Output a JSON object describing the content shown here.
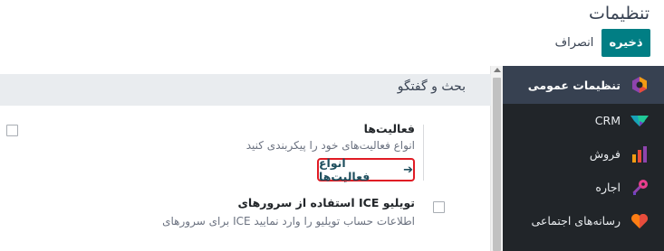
{
  "header": {
    "title": "تنظیمات",
    "save_label": "ذخیره",
    "discard_label": "انصراف"
  },
  "sidebar": {
    "items": [
      {
        "label": "تنظیمات عمومی",
        "icon": "settings-hexagon-icon",
        "active": true
      },
      {
        "label": "CRM",
        "icon": "crm-handshake-icon",
        "active": false
      },
      {
        "label": "فروش",
        "icon": "sales-chart-icon",
        "active": false
      },
      {
        "label": "اجاره",
        "icon": "rental-key-icon",
        "active": false
      },
      {
        "label": "رسانه‌های اجتماعی",
        "icon": "social-heart-icon",
        "active": false
      }
    ]
  },
  "main": {
    "section_title": "بحث و گفتگو",
    "settings": [
      {
        "title": "فعالیت‌ها",
        "description": "انواع فعالیت‌های خود را پیکربندی کنید",
        "link_label": "انواع فعالیت‌ها"
      },
      {
        "title": "استفاده از سرورهای ICE تویلیو",
        "description": "برای سرورهای ICE اطلاعات حساب تویلیو را وارد نمایید"
      }
    ]
  },
  "colors": {
    "primary": "#017e84",
    "sidebar_bg": "#212529",
    "sidebar_active": "#374151",
    "highlight_border": "#e01b24"
  }
}
